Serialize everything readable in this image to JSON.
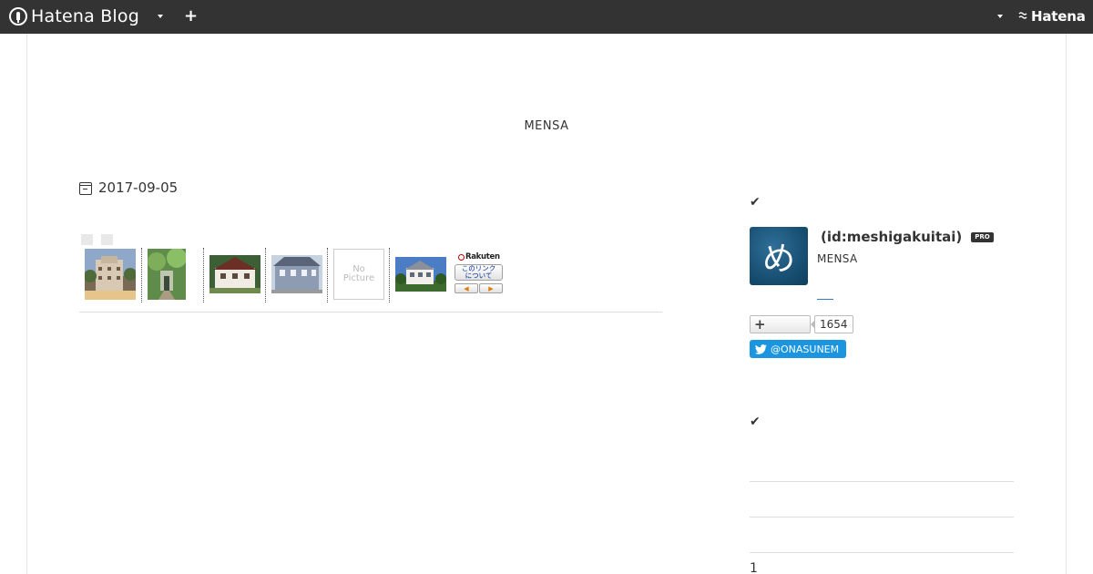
{
  "globalheader": {
    "logo_text": "Hatena Blog",
    "hatena_text": "Hatena"
  },
  "blog": {
    "title": "MENSA"
  },
  "entry": {
    "date": "2017-09-05"
  },
  "rakuten": {
    "logo_text": "Rakuten",
    "nopic_line1": "No",
    "nopic_line2": "Picture",
    "about_line1": "このリンク",
    "about_line2": "について",
    "prev_glyph": "◀",
    "next_glyph": "▶"
  },
  "sidebar": {
    "profile": {
      "id_text": "(id:meshigakuitai)",
      "pro_badge": "PRO",
      "avatar_char": "め",
      "description": "MENSA",
      "follower_count": "1654",
      "twitter_handle": "@ONASUNEM"
    },
    "archive_first": "1"
  },
  "colors": {
    "header_bg": "#333333",
    "twitter_blue": "#1b95e0",
    "avatar_blue": "#154b6d",
    "link_blue": "#2e7bcf"
  },
  "icons": {
    "header_logo": "hatena-blog-logo-icon",
    "calendar": "calendar-icon",
    "check": "check-icon",
    "twitter": "twitter-bird-icon",
    "plus": "plus-icon"
  }
}
